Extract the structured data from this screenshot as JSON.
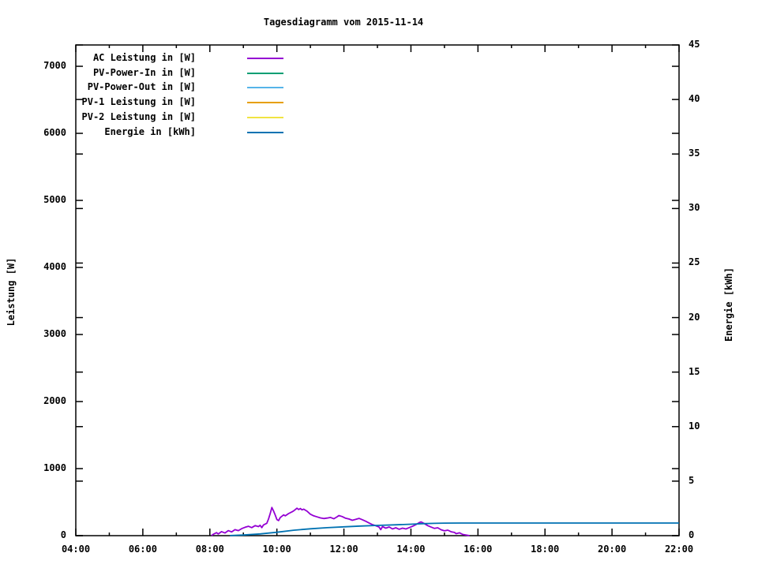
{
  "title": "Tagesdiagramm vom 2015-11-14",
  "axes": {
    "left": {
      "label": "Leistung [W]"
    },
    "right": {
      "label": "Energie [kWh]"
    }
  },
  "colors": {
    "foreground": "#000000",
    "background": "#ffffff",
    "ac": "#9400d3",
    "pv_power_in": "#009e73",
    "pv_power_out": "#56b4e9",
    "pv1": "#e69f00",
    "pv2": "#f0e442",
    "energie": "#0072b2"
  },
  "chart_data": {
    "type": "line",
    "title": "Tagesdiagramm vom 2015-11-14",
    "xlabel": "",
    "x_unit": "time of day (HH:MM)",
    "grid": false,
    "legend_position": "inside top-left",
    "x_axis": {
      "min": 4,
      "max": 22,
      "major_tick_hours": [
        4,
        6,
        8,
        10,
        12,
        14,
        16,
        18,
        20,
        22
      ],
      "major_tick_labels": [
        "04:00",
        "06:00",
        "08:00",
        "10:00",
        "12:00",
        "14:00",
        "16:00",
        "18:00",
        "20:00",
        "22:00"
      ],
      "minor_tick_hours": [
        5,
        7,
        9,
        11,
        13,
        15,
        17,
        19,
        21
      ]
    },
    "y_left": {
      "label": "Leistung [W]",
      "min": 0,
      "max": 7318,
      "ticks": [
        0,
        1000,
        2000,
        3000,
        4000,
        5000,
        6000,
        7000
      ]
    },
    "y_right": {
      "label": "Energie [kWh]",
      "min": 0,
      "max": 45,
      "ticks": [
        0,
        5,
        10,
        15,
        20,
        25,
        30,
        35,
        40,
        45
      ]
    },
    "series": [
      {
        "name": "AC Leistung in [W]",
        "color": "#9400d3",
        "axis": "left",
        "points": [
          [
            8.05,
            0
          ],
          [
            8.1,
            20
          ],
          [
            8.2,
            45
          ],
          [
            8.25,
            25
          ],
          [
            8.35,
            60
          ],
          [
            8.45,
            40
          ],
          [
            8.55,
            75
          ],
          [
            8.65,
            55
          ],
          [
            8.75,
            90
          ],
          [
            8.85,
            75
          ],
          [
            8.95,
            105
          ],
          [
            9.05,
            125
          ],
          [
            9.15,
            140
          ],
          [
            9.25,
            120
          ],
          [
            9.35,
            150
          ],
          [
            9.45,
            135
          ],
          [
            9.5,
            155
          ],
          [
            9.55,
            120
          ],
          [
            9.6,
            160
          ],
          [
            9.7,
            185
          ],
          [
            9.75,
            250
          ],
          [
            9.8,
            330
          ],
          [
            9.85,
            420
          ],
          [
            9.9,
            370
          ],
          [
            9.95,
            310
          ],
          [
            10.0,
            240
          ],
          [
            10.05,
            225
          ],
          [
            10.1,
            270
          ],
          [
            10.2,
            310
          ],
          [
            10.25,
            295
          ],
          [
            10.35,
            330
          ],
          [
            10.45,
            355
          ],
          [
            10.5,
            370
          ],
          [
            10.55,
            390
          ],
          [
            10.6,
            410
          ],
          [
            10.65,
            390
          ],
          [
            10.7,
            405
          ],
          [
            10.75,
            385
          ],
          [
            10.8,
            395
          ],
          [
            10.9,
            365
          ],
          [
            11.0,
            320
          ],
          [
            11.1,
            295
          ],
          [
            11.2,
            280
          ],
          [
            11.3,
            265
          ],
          [
            11.4,
            255
          ],
          [
            11.5,
            262
          ],
          [
            11.6,
            272
          ],
          [
            11.7,
            252
          ],
          [
            11.8,
            282
          ],
          [
            11.85,
            300
          ],
          [
            11.95,
            285
          ],
          [
            12.05,
            260
          ],
          [
            12.15,
            248
          ],
          [
            12.25,
            230
          ],
          [
            12.35,
            242
          ],
          [
            12.45,
            258
          ],
          [
            12.55,
            238
          ],
          [
            12.65,
            215
          ],
          [
            12.75,
            190
          ],
          [
            12.85,
            165
          ],
          [
            12.95,
            148
          ],
          [
            13.05,
            128
          ],
          [
            13.1,
            90
          ],
          [
            13.15,
            135
          ],
          [
            13.25,
            112
          ],
          [
            13.35,
            130
          ],
          [
            13.45,
            100
          ],
          [
            13.55,
            118
          ],
          [
            13.65,
            95
          ],
          [
            13.75,
            112
          ],
          [
            13.85,
            100
          ],
          [
            13.95,
            120
          ],
          [
            14.05,
            140
          ],
          [
            14.15,
            165
          ],
          [
            14.25,
            195
          ],
          [
            14.3,
            205
          ],
          [
            14.4,
            180
          ],
          [
            14.5,
            150
          ],
          [
            14.6,
            128
          ],
          [
            14.7,
            108
          ],
          [
            14.8,
            118
          ],
          [
            14.9,
            88
          ],
          [
            15.0,
            72
          ],
          [
            15.1,
            82
          ],
          [
            15.2,
            58
          ],
          [
            15.3,
            48
          ],
          [
            15.35,
            30
          ],
          [
            15.45,
            42
          ],
          [
            15.55,
            18
          ],
          [
            15.65,
            8
          ],
          [
            15.75,
            0
          ]
        ]
      },
      {
        "name": "PV-Power-In in [W]",
        "color": "#009e73",
        "axis": "left",
        "points": []
      },
      {
        "name": "PV-Power-Out in [W]",
        "color": "#56b4e9",
        "axis": "left",
        "points": []
      },
      {
        "name": "PV-1 Leistung in [W]",
        "color": "#e69f00",
        "axis": "left",
        "points": []
      },
      {
        "name": "PV-2 Leistung in [W]",
        "color": "#f0e442",
        "axis": "left",
        "points": []
      },
      {
        "name": "Energie in [kWh]",
        "color": "#0072b2",
        "axis": "right",
        "points": [
          [
            8.6,
            0.01
          ],
          [
            9.0,
            0.06
          ],
          [
            9.5,
            0.16
          ],
          [
            10.0,
            0.31
          ],
          [
            10.5,
            0.5
          ],
          [
            11.0,
            0.63
          ],
          [
            11.5,
            0.73
          ],
          [
            12.0,
            0.81
          ],
          [
            12.5,
            0.88
          ],
          [
            13.0,
            0.94
          ],
          [
            13.5,
            0.99
          ],
          [
            14.0,
            1.05
          ],
          [
            14.35,
            1.1
          ],
          [
            14.7,
            1.13
          ],
          [
            15.0,
            1.15
          ],
          [
            15.5,
            1.16
          ],
          [
            16.0,
            1.16
          ],
          [
            22.0,
            1.16
          ]
        ]
      }
    ]
  },
  "legend": [
    {
      "label": "AC Leistung in [W]",
      "color": "#9400d3"
    },
    {
      "label": "PV-Power-In in [W]",
      "color": "#009e73"
    },
    {
      "label": "PV-Power-Out in [W]",
      "color": "#56b4e9"
    },
    {
      "label": "PV-1 Leistung in [W]",
      "color": "#e69f00"
    },
    {
      "label": "PV-2 Leistung in [W]",
      "color": "#f0e442"
    },
    {
      "label": "Energie in [kWh]",
      "color": "#0072b2"
    }
  ]
}
